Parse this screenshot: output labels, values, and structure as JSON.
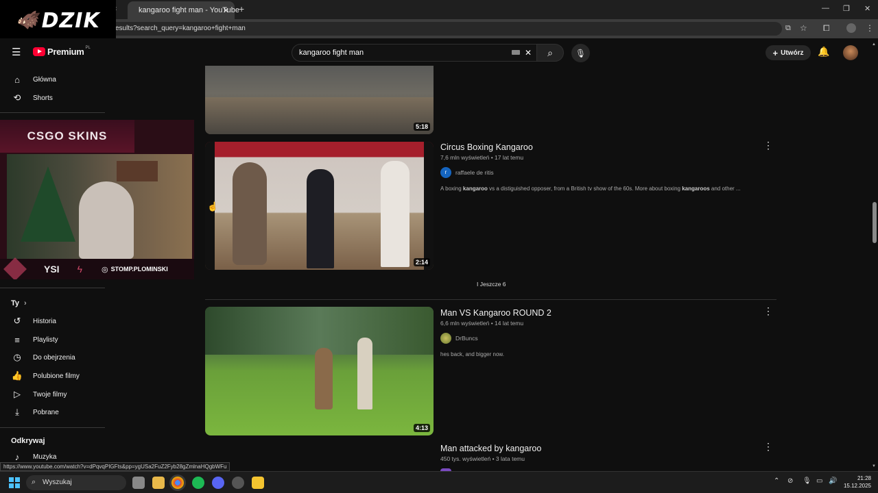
{
  "browser": {
    "tab_title": "kangaroo fight man - YouTube",
    "address": "esults?search_query=kangaroo+fight+man",
    "status_url": "https://www.youtube.com/watch?v=dPqvqPIGFts&pp=ygUSa2FuZ2Fyb28gZmlnaHQgbWFu"
  },
  "overlay": {
    "logo": "DZIK",
    "sponsor": "CSGO SKINS",
    "instagram": "STOMP.PLOMINSKI"
  },
  "masthead": {
    "brand": "Premium",
    "brand_region": "PL",
    "search_value": "kangaroo fight man",
    "create_label": "Utwórz"
  },
  "sidebar": {
    "top": [
      {
        "label": "Główna",
        "icon": "home-icon"
      },
      {
        "label": "Shorts",
        "icon": "shorts-icon"
      }
    ],
    "you_label": "Ty",
    "you_items": [
      {
        "label": "Historia",
        "icon": "history-icon"
      },
      {
        "label": "Playlisty",
        "icon": "playlist-icon"
      },
      {
        "label": "Do obejrzenia",
        "icon": "watch-later-icon"
      },
      {
        "label": "Polubione filmy",
        "icon": "like-icon"
      },
      {
        "label": "Twoje filmy",
        "icon": "your-videos-icon"
      },
      {
        "label": "Pobrane",
        "icon": "download-icon"
      }
    ],
    "explore_label": "Odkrywaj",
    "explore_items": [
      {
        "label": "Muzyka",
        "icon": "music-icon"
      }
    ]
  },
  "results": {
    "top_partial_duration": "5:18",
    "videos": [
      {
        "title": "Circus Boxing Kangaroo",
        "meta": "7,6 mln wyświetleń • 17 lat temu",
        "channel": "raffaele de ritis",
        "channel_initial": "r",
        "description_parts": [
          "A boxing ",
          "kangaroo",
          " vs a distiguished opposer, from a British tv show of the 60s. More about boxing ",
          "kangaroos",
          " and other ..."
        ],
        "duration": "2:14"
      },
      {
        "title": "Man VS Kangaroo ROUND 2",
        "meta": "6,6 mln wyświetleń • 14 lat temu",
        "channel": "DrBuncs",
        "description": "hes back, and bigger now.",
        "duration": "4:13"
      },
      {
        "title": "Man attacked by kangaroo",
        "meta": "450 tys. wyświetleń • 3 lata temu"
      }
    ],
    "more_label": "I Jeszcze 6"
  },
  "taskbar": {
    "search_placeholder": "Wyszukaj",
    "time": "21:28",
    "date": "15.12.2025"
  }
}
